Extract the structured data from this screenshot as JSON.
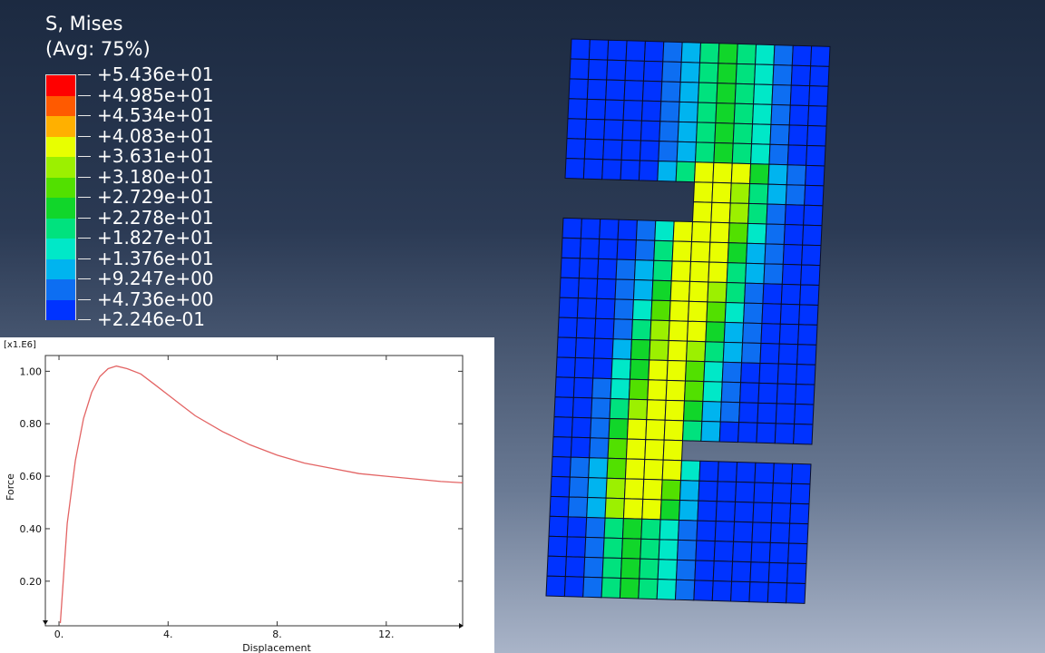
{
  "legend": {
    "title_line1": "S, Mises",
    "title_line2": "(Avg: 75%)",
    "entries": [
      {
        "label": "+5.436e+01",
        "color": "#ff0000"
      },
      {
        "label": "+4.985e+01",
        "color": "#ff5a00"
      },
      {
        "label": "+4.534e+01",
        "color": "#ffb000"
      },
      {
        "label": "+4.083e+01",
        "color": "#e8ff00"
      },
      {
        "label": "+3.631e+01",
        "color": "#9cf000"
      },
      {
        "label": "+3.180e+01",
        "color": "#52e000"
      },
      {
        "label": "+2.729e+01",
        "color": "#11d62a"
      },
      {
        "label": "+2.278e+01",
        "color": "#00e27e"
      },
      {
        "label": "+1.827e+01",
        "color": "#00e8c8"
      },
      {
        "label": "+1.376e+01",
        "color": "#00b4ef"
      },
      {
        "label": "+9.247e+00",
        "color": "#0d6ef2"
      },
      {
        "label": "+4.736e+00",
        "color": "#0033ff"
      },
      {
        "label": "+2.246e-01",
        "color": "#0000ff"
      }
    ]
  },
  "chart_data": {
    "type": "line",
    "multiplier": "[x1.E6]",
    "xlabel": "Displacement",
    "ylabel": "Force",
    "xlim": [
      -0.5,
      14.8
    ],
    "ylim": [
      0.03,
      1.06
    ],
    "x_ticks": [
      {
        "value": 0,
        "label": "0."
      },
      {
        "value": 4,
        "label": "4."
      },
      {
        "value": 8,
        "label": "8."
      },
      {
        "value": 12,
        "label": "12."
      }
    ],
    "y_ticks": [
      {
        "value": 0.2,
        "label": "0.20"
      },
      {
        "value": 0.4,
        "label": "0.40"
      },
      {
        "value": 0.6,
        "label": "0.60"
      },
      {
        "value": 0.8,
        "label": "0.80"
      },
      {
        "value": 1.0,
        "label": "1.00"
      }
    ],
    "series_color": "#e36464",
    "x": [
      0.05,
      0.3,
      0.6,
      0.9,
      1.2,
      1.5,
      1.8,
      2.1,
      2.5,
      3.0,
      3.5,
      4.0,
      4.5,
      5.0,
      6.0,
      7.0,
      8.0,
      9.0,
      10.0,
      11.0,
      12.0,
      13.0,
      14.0,
      14.8
    ],
    "y": [
      0.04,
      0.42,
      0.66,
      0.82,
      0.92,
      0.98,
      1.01,
      1.02,
      1.01,
      0.99,
      0.95,
      0.91,
      0.87,
      0.83,
      0.77,
      0.72,
      0.68,
      0.65,
      0.63,
      0.61,
      0.6,
      0.59,
      0.58,
      0.575
    ]
  }
}
